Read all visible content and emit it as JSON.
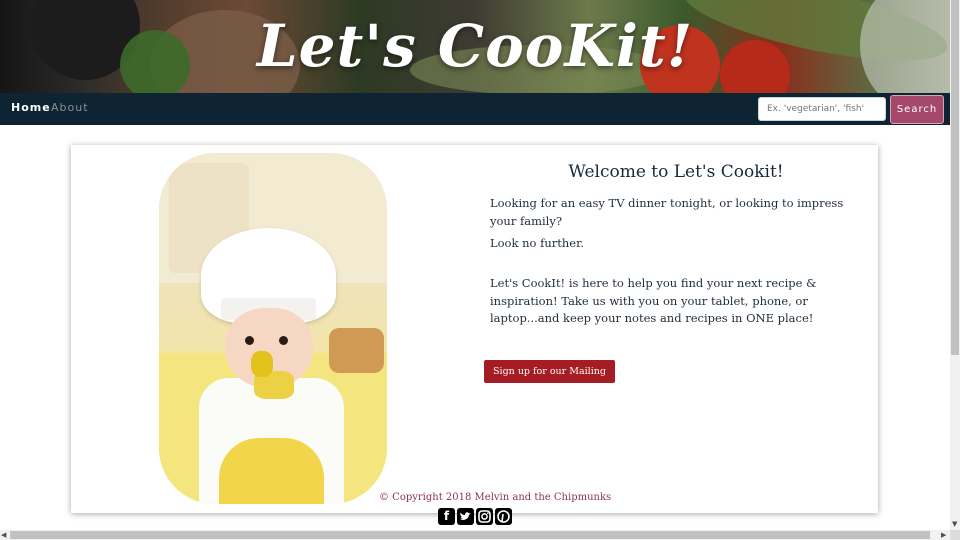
{
  "header": {
    "logo_text": "Let's CooKit!"
  },
  "nav": {
    "home_label": "Home",
    "about_label": "About",
    "search_placeholder": "Ex. 'vegetarian', 'fish'",
    "search_button": "Search"
  },
  "main": {
    "welcome_title": "Welcome to Let's Cookit!",
    "paragraphs": [
      "Looking for an easy TV dinner tonight, or looking to impress your family?",
      "Look no further.",
      "Let's CookIt! is here to help you find your next recipe & inspiration! Take us with you on your tablet, phone, or laptop...and keep your notes and recipes in ONE place!"
    ],
    "signup_button": "Sign up for our Mailing List"
  },
  "footer": {
    "copyright": "© Copyright 2018 Melvin and the Chipmunks",
    "social_icons": [
      "facebook-icon",
      "twitter-icon",
      "instagram-icon",
      "pinterest-icon"
    ]
  },
  "colors": {
    "navbar": "#0e2432",
    "search_button": "#a5496a",
    "signup_button": "#a51c24",
    "copyright_text": "#8e3547"
  }
}
